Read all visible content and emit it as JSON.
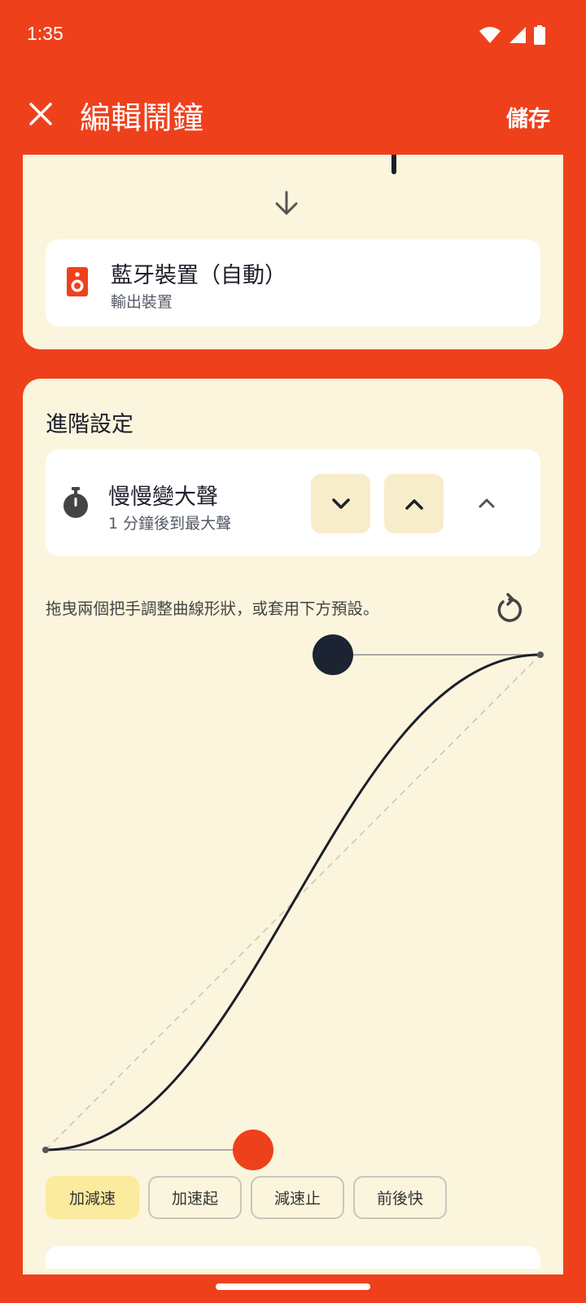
{
  "status": {
    "time": "1:35"
  },
  "appbar": {
    "title": "編輯鬧鐘",
    "save_label": "儲存"
  },
  "output": {
    "device_name": "藍牙裝置（自動）",
    "device_sub": "輸出裝置"
  },
  "advanced": {
    "heading": "進階設定",
    "fade_title": "慢慢變大聲",
    "fade_sub": "1 分鐘後到最大聲",
    "hint": "拖曳兩個把手調整曲線形狀，或套用下方預設。"
  },
  "presets": [
    "加減速",
    "加速起",
    "減速止",
    "前後快"
  ],
  "colors": {
    "accent": "#EF401C",
    "card": "#FAF5DC",
    "ink": "#1C1F2A",
    "active_preset": "#FBEB9E"
  }
}
